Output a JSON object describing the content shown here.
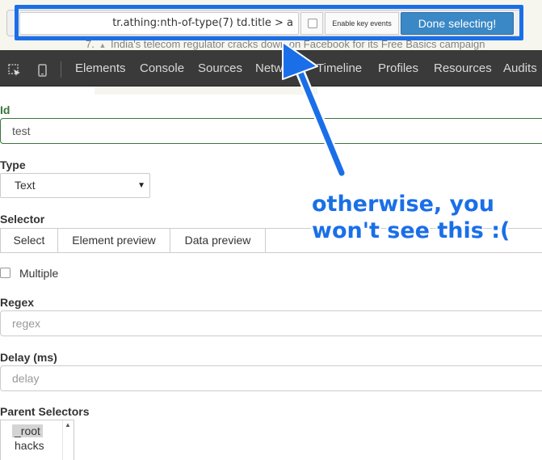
{
  "background_page": {
    "rank": "7.",
    "headline": "India's telecom regulator cracks down on Facebook for its Free Basics campaign"
  },
  "selection_bar": {
    "selector_value": "tr.athing:nth-of-type(7) td.title > a",
    "enable_key_events_label": "Enable key events",
    "done_button_label": "Done selecting!"
  },
  "devtools": {
    "tabs": [
      "Elements",
      "Console",
      "Sources",
      "Network",
      "Timeline",
      "Profiles",
      "Resources",
      "Audits"
    ]
  },
  "form": {
    "id_label": "Id",
    "id_value": "test",
    "type_label": "Type",
    "type_value": "Text",
    "selector_label": "Selector",
    "selector_buttons": [
      "Select",
      "Element preview",
      "Data preview"
    ],
    "multiple_label": "Multiple",
    "regex_label": "Regex",
    "regex_placeholder": "regex",
    "delay_label": "Delay (ms)",
    "delay_placeholder": "delay",
    "parent_selectors_label": "Parent Selectors",
    "parent_selectors": [
      "_root",
      "hacks"
    ]
  },
  "annotation": {
    "lines": [
      "otherwise, you",
      "won't see this :("
    ],
    "color": "#1a6fe8"
  },
  "colors": {
    "accent": "#1a6fe8",
    "done_button": "#3a88c6",
    "devtools_bg": "#3a3a3a",
    "valid_green": "#3c763d"
  }
}
